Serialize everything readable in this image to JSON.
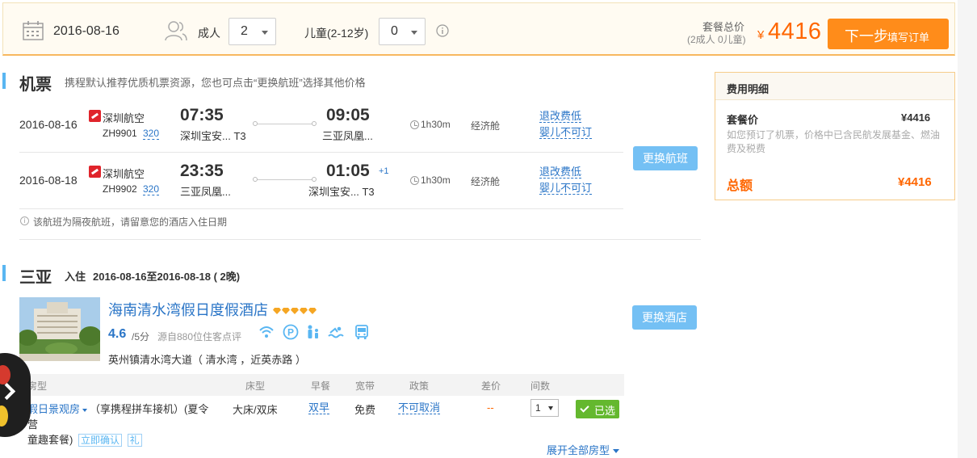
{
  "topbar": {
    "date": "2016-08-16",
    "adult_label": "成人",
    "adult_count": "2",
    "child_label": "儿童(2-12岁)",
    "child_count": "0",
    "total_label": "套餐总价",
    "total_sub": "(2成人 0儿童)",
    "currency": "¥",
    "total_price": "4416",
    "next_main": "下一步",
    "next_sub": "填写订单"
  },
  "flights_section": {
    "title": "机票",
    "note": "携程默认推荐优质机票资源，您也可点击“更换航班”选择其他价格",
    "change_label": "更换航班",
    "overnight_note": "该航班为隔夜航班，请留意您的酒店入住日期",
    "rows": [
      {
        "date": "2016-08-16",
        "airline": "深圳航空",
        "flight_no": "ZH9901",
        "plane": "320",
        "dep_time": "07:35",
        "dep_airport": "深圳宝安... T3",
        "arr_time": "09:05",
        "arr_plus": "",
        "arr_airport": "三亚凤凰...",
        "duration": "1h30m",
        "cabin": "经济舱",
        "refund": "退改费低",
        "infant": "婴儿不可订"
      },
      {
        "date": "2016-08-18",
        "airline": "深圳航空",
        "flight_no": "ZH9902",
        "plane": "320",
        "dep_time": "23:35",
        "dep_airport": "三亚凤凰...",
        "arr_time": "01:05",
        "arr_plus": "+1",
        "arr_airport": "深圳宝安... T3",
        "duration": "1h30m",
        "cabin": "经济舱",
        "refund": "退改费低",
        "infant": "婴儿不可订"
      }
    ]
  },
  "hotel_section": {
    "city": "三亚",
    "checkin_label": "入住",
    "stay": "2016-08-16至2016-08-18 ( 2晚)",
    "name": "海南清水湾假日度假酒店",
    "score": "4.6",
    "score_max": "/5分",
    "reviews": "源自880位住客点评",
    "address": "英州镇清水湾大道（ 清水湾 ，近英赤路 ）",
    "change_label": "更换酒店",
    "diamond_count": 5,
    "facilities": [
      "wifi-icon",
      "parking-icon",
      "family-icon",
      "swimming-icon",
      "bus-icon"
    ]
  },
  "room_table": {
    "headers": {
      "room_type": "房型",
      "bed": "床型",
      "breakfast": "早餐",
      "broadband": "宽带",
      "policy": "政策",
      "diff": "差价",
      "count": "间数"
    },
    "room": {
      "name_prefix": "假日景观房",
      "name_rest": "（享携程拼车接机）(夏令营",
      "name_line2": "童趣套餐)",
      "tag_confirm": "立即确认",
      "tag_gift": "礼",
      "bed": "大床/双床",
      "breakfast": "双早",
      "broadband": "免费",
      "policy": "不可取消",
      "diff": "--",
      "qty": "1",
      "chosen": "已选"
    },
    "expand_all": "展开全部房型"
  },
  "fee_panel": {
    "title": "费用明细",
    "package_label": "套餐价",
    "package_value": "¥4416",
    "desc": "如您预订了机票，价格中已含民航发展基金、燃油费及税费",
    "total_label": "总额",
    "total_value": "¥4416"
  },
  "colors": {
    "accent_orange": "#ff8c1a",
    "price_orange": "#ff6600",
    "link_blue": "#2a75c7",
    "button_blue": "#74c0f4",
    "chosen_green": "#64b82e"
  }
}
